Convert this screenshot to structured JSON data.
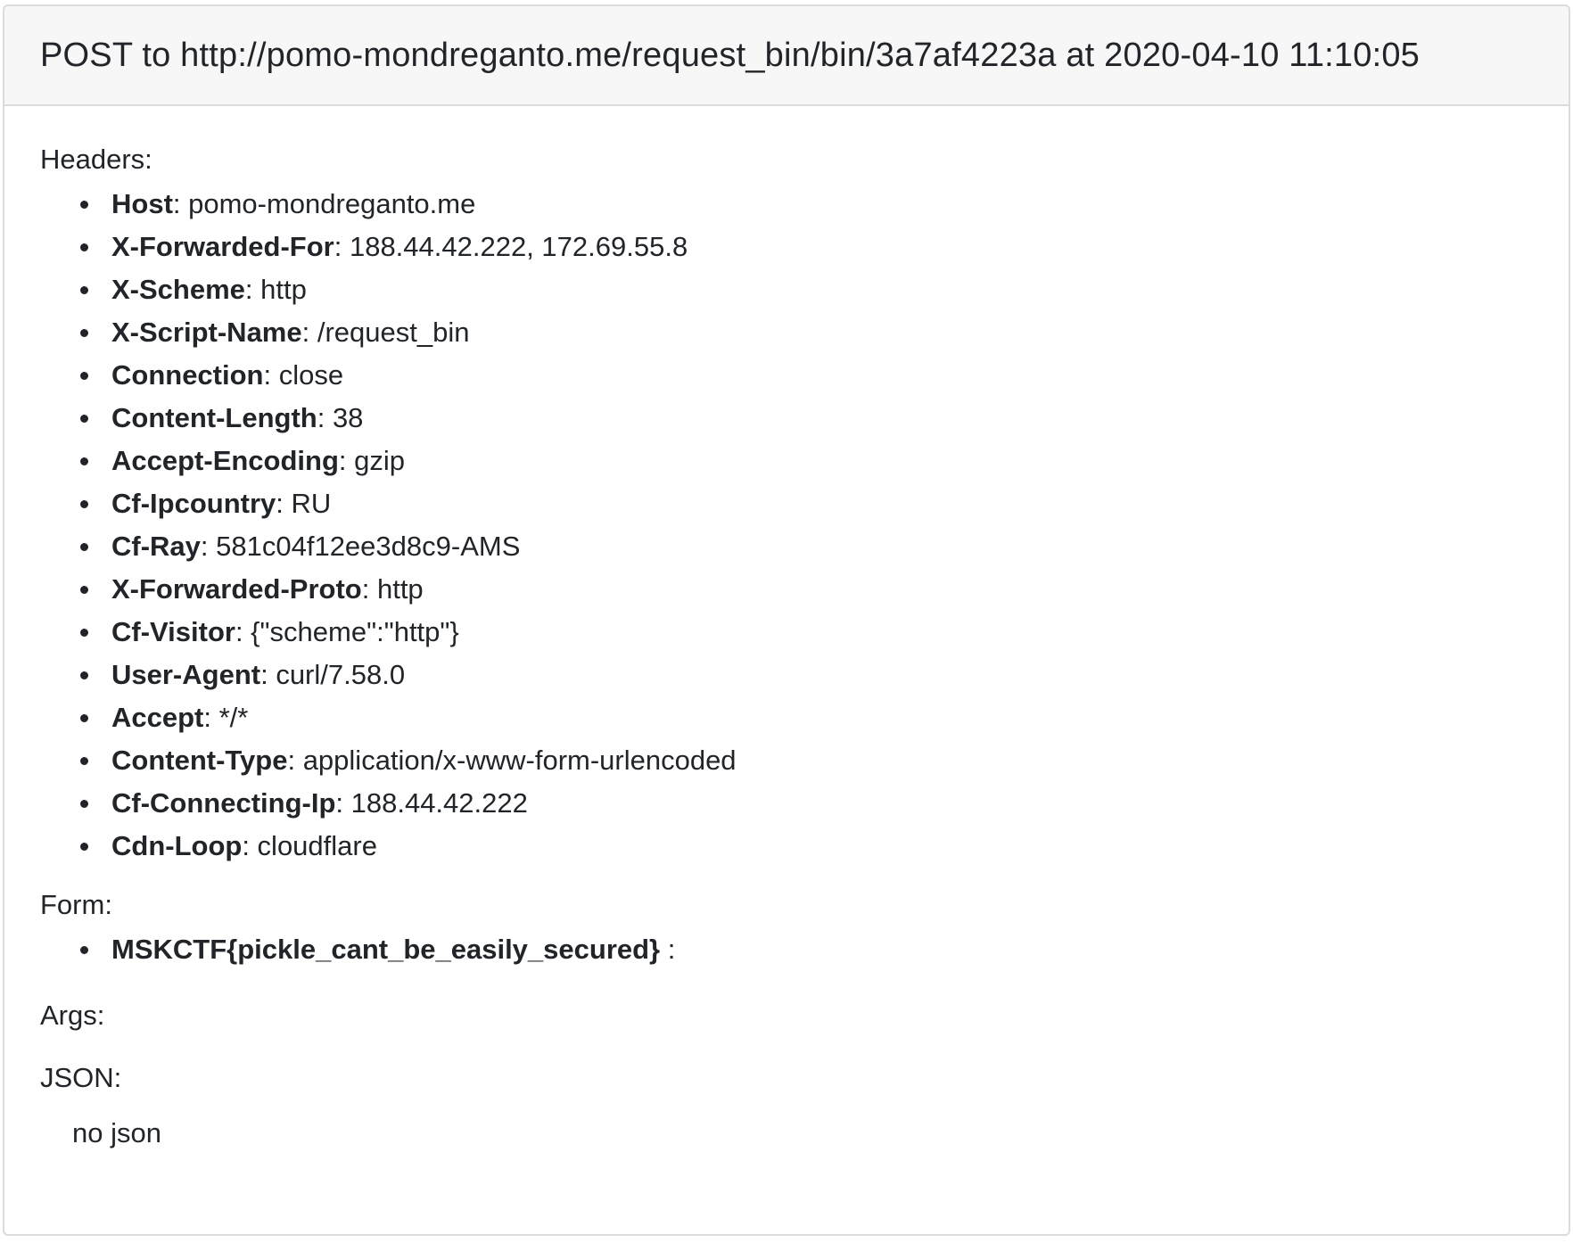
{
  "header": {
    "title": "POST to http://pomo-mondreganto.me/request_bin/bin/3a7af4223a at 2020-04-10 11:10:05"
  },
  "sections": {
    "headers_label": "Headers:",
    "form_label": "Form:",
    "args_label": "Args:",
    "json_label": "JSON:"
  },
  "headers": [
    {
      "name": "Host",
      "value": ": pomo-mondreganto.me"
    },
    {
      "name": "X-Forwarded-For",
      "value": ": 188.44.42.222, 172.69.55.8"
    },
    {
      "name": "X-Scheme",
      "value": ": http"
    },
    {
      "name": "X-Script-Name",
      "value": ": /request_bin"
    },
    {
      "name": "Connection",
      "value": ": close"
    },
    {
      "name": "Content-Length",
      "value": ": 38"
    },
    {
      "name": "Accept-Encoding",
      "value": ": gzip"
    },
    {
      "name": "Cf-Ipcountry",
      "value": ": RU"
    },
    {
      "name": "Cf-Ray",
      "value": ": 581c04f12ee3d8c9-AMS"
    },
    {
      "name": "X-Forwarded-Proto",
      "value": ": http"
    },
    {
      "name": "Cf-Visitor",
      "value": ": {\"scheme\":\"http\"}"
    },
    {
      "name": "User-Agent",
      "value": ": curl/7.58.0"
    },
    {
      "name": "Accept",
      "value": ": */*"
    },
    {
      "name": "Content-Type",
      "value": ": application/x-www-form-urlencoded"
    },
    {
      "name": "Cf-Connecting-Ip",
      "value": ": 188.44.42.222"
    },
    {
      "name": "Cdn-Loop",
      "value": ": cloudflare"
    }
  ],
  "form": [
    {
      "name": "MSKCTF{pickle_cant_be_easily_secured}",
      "value": " :"
    }
  ],
  "json": {
    "value": "no json"
  }
}
